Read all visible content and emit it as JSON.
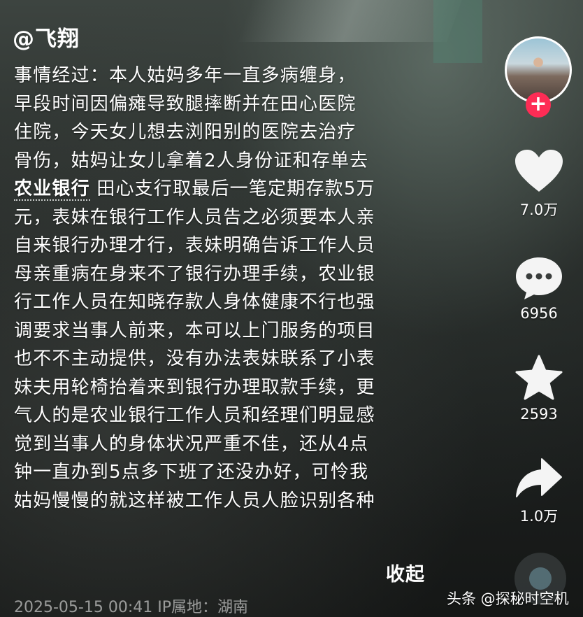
{
  "post": {
    "author": "@飞翔",
    "body_lines": [
      "事情经过：本人姑妈多年一直多病缠身，",
      "早段时间因偏瘫导致腿摔断并在田心医院",
      "住院，今天女儿想去浏阳别的医院去治疗",
      "骨伤，姑妈让女儿拿着2人身份证和存单去"
    ],
    "link_word": "农业银行",
    "link_line_rest": "田心支行取最后一笔定期存款5万",
    "body_lines_after": [
      "元，表妹在银行工作人员告之必须要本人亲",
      "自来银行办理才行，表妹明确告诉工作人员",
      "母亲重病在身来不了银行办理手续，农业银",
      "行工作人员在知晓存款人身体健康不行也强",
      "调要求当事人前来，本可以上门服务的项目",
      "也不不主动提供，没有办法表妹联系了小表",
      "妹夫用轮椅抬着来到银行办理取款手续，更",
      "气人的是农业银行工作人员和经理们明显感",
      "觉到当事人的身体状况严重不佳，还从4点",
      "钟一直办到5点多下班了还没办好，可怜我",
      "姑妈慢慢的就这样被工作人员人脸识别各种"
    ],
    "collapse_label": "收起",
    "timestamp": "2025-05-15 00:41",
    "location": "IP属地：湖南"
  },
  "sidebar": {
    "follow_symbol": "+",
    "like_count": "7.0万",
    "comment_count": "6956",
    "favorite_count": "2593",
    "share_count": "1.0万",
    "icons": {
      "like": "heart-icon",
      "comment": "comment-bubble-icon",
      "favorite": "star-icon",
      "share": "share-arrow-icon"
    }
  },
  "watermark": "头条 @探秘时空机",
  "colors": {
    "follow_button": "#fe2c55",
    "text": "#ffffff"
  }
}
